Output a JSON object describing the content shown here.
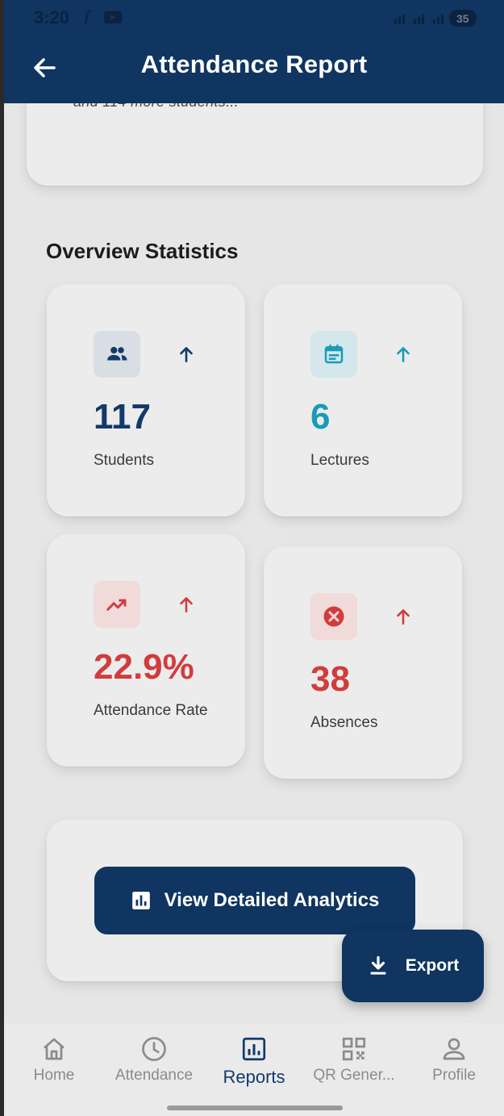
{
  "status": {
    "time": "3:20",
    "battery": "35"
  },
  "header": {
    "title": "Attendance Report"
  },
  "students_more": {
    "text": "and 114 more students..."
  },
  "overview": {
    "title": "Overview Statistics",
    "stats": [
      {
        "value": "117",
        "label": "Students",
        "icon": "group-icon",
        "color": "#123a6a",
        "tint": "#d9dee5"
      },
      {
        "value": "6",
        "label": "Lectures",
        "icon": "calendar-icon",
        "color": "#1a9bb8",
        "tint": "#d3e7ec"
      },
      {
        "value": "22.9%",
        "label": "Attendance Rate",
        "icon": "trending-up-icon",
        "color": "#d23c3c",
        "tint": "#f0dada"
      },
      {
        "value": "38",
        "label": "Absences",
        "icon": "cancel-icon",
        "color": "#d23c3c",
        "tint": "#f0dada"
      }
    ]
  },
  "actions": {
    "analytics_label": "View Detailed Analytics",
    "export_label": "Export"
  },
  "nav": {
    "items": [
      {
        "label": "Home",
        "icon": "home-icon"
      },
      {
        "label": "Attendance",
        "icon": "clock-icon"
      },
      {
        "label": "Reports",
        "icon": "reports-icon",
        "active": true
      },
      {
        "label": "QR Gener...",
        "icon": "qr-code-icon"
      },
      {
        "label": "Profile",
        "icon": "person-icon"
      }
    ]
  }
}
